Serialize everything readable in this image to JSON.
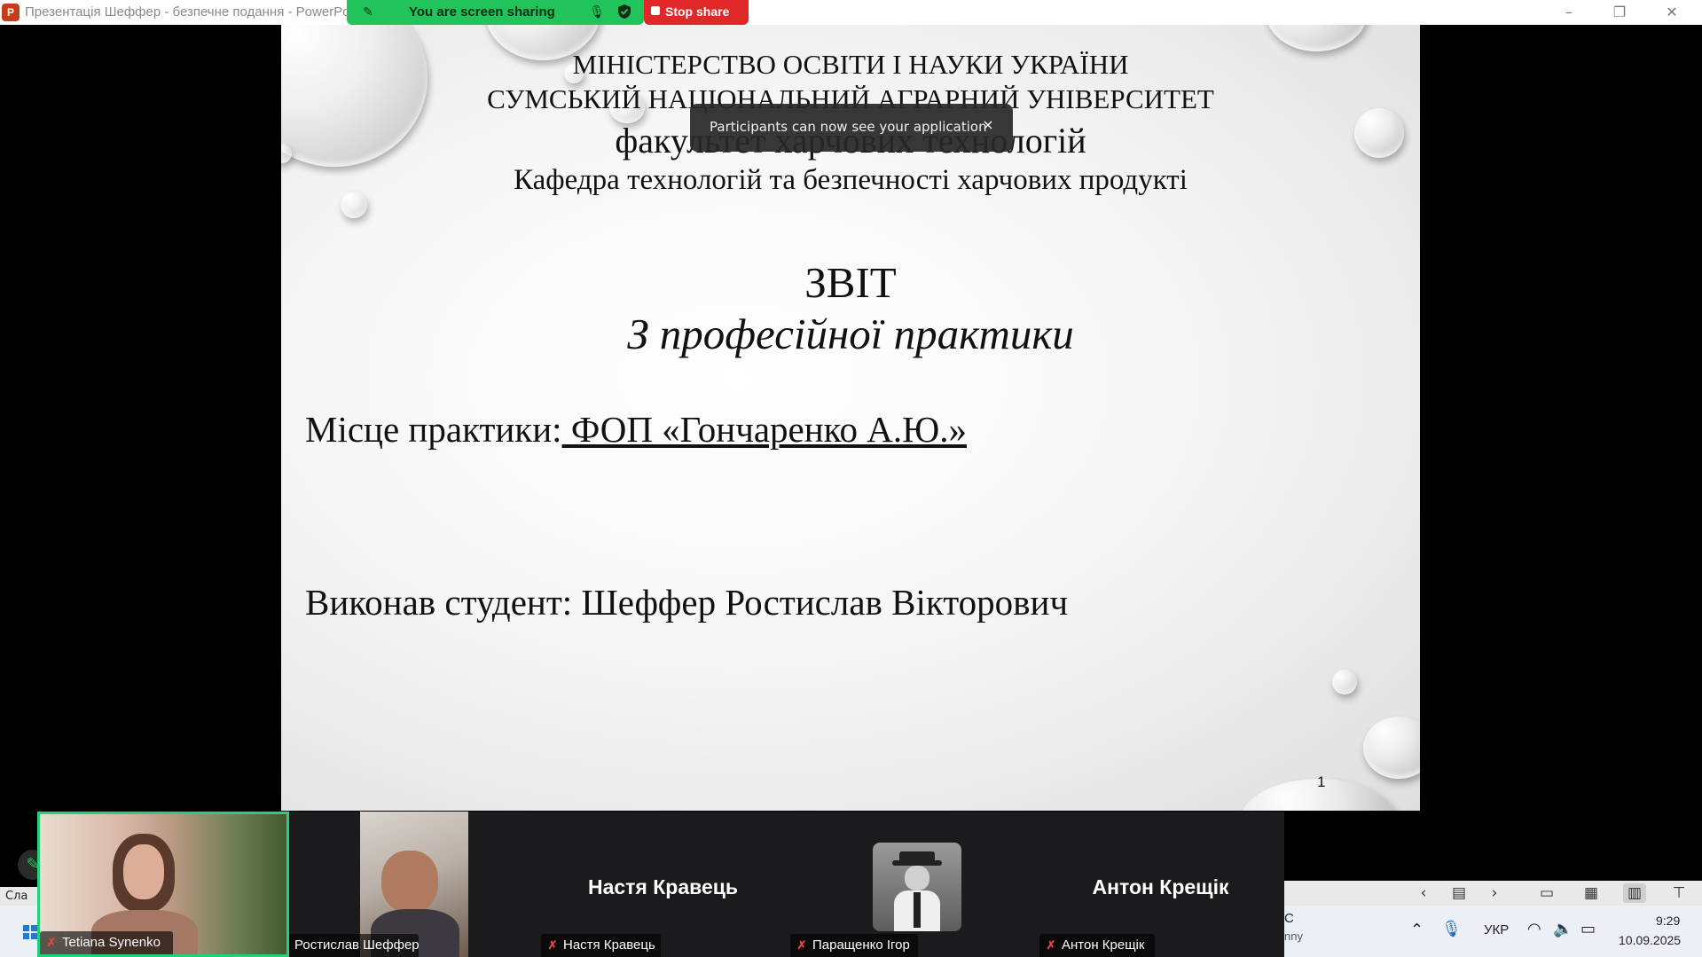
{
  "titlebar": {
    "app_letter": "P",
    "title": "Презентація Шеффер  -  безпечне подання - PowerPo",
    "minimize": "–",
    "restore": "❐",
    "close": "✕"
  },
  "share_bar": {
    "label": "You are screen sharing",
    "stop_label": "Stop share",
    "color": "#21c45a",
    "stop_color": "#e02828"
  },
  "toast": {
    "text": "Participants can now see your application",
    "close": "×"
  },
  "slide": {
    "line1": "МІНІСТЕРСТВО ОСВІТИ І НАУКИ УКРАЇНИ",
    "line2": "СУМСЬКИЙ НАЦІОНАЛЬНИЙ АГРАРНИЙ УНІВЕРСИТЕТ",
    "line3": "факультет харчових технологій",
    "line4": "Кафедра технологій та безпечності харчових продукті",
    "heading": "ЗВІТ",
    "subheading": "З професійної практики",
    "place_label": "Місце практики:",
    "place_value": " ФОП «Гончаренко А.Ю.»",
    "student": "Виконав студент: Шеффер Ростислав Вікторович",
    "page_number": "1"
  },
  "gallery": {
    "tiles": [
      {
        "name": "Tetiana Synenko",
        "muted": true
      },
      {
        "name": "Ростислав Шеффер",
        "muted": false
      },
      {
        "name": "Настя Кравець",
        "muted": true
      },
      {
        "name": "Паращенко Ігор",
        "muted": true
      },
      {
        "name": "Антон Крещік",
        "muted": true
      }
    ],
    "accent": "#24d17b"
  },
  "side_tab": "Сла",
  "ppt_status": {
    "icons": [
      "chevron-left",
      "slide-sorter",
      "chevron-right",
      "normal-view",
      "grid-view",
      "reading-view",
      "presenter-view"
    ]
  },
  "taskbar": {
    "weather_temp": "С",
    "weather_desc": "nny",
    "language": "УКР",
    "time": "9:29",
    "date": "10.09.2025"
  }
}
